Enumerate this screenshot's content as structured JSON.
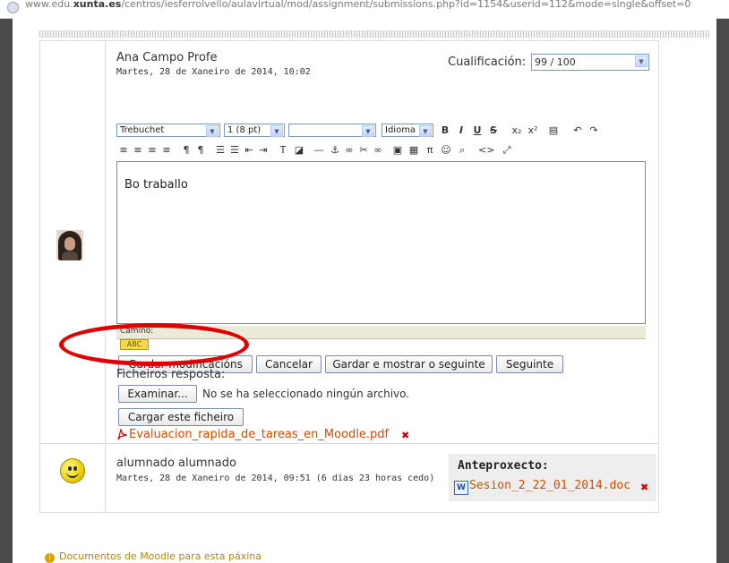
{
  "browser": {
    "url_prefix": "www.edu.",
    "url_domain": "xunta.es",
    "url_path": "/centros/iesferrolvello/aulavirtual/mod/assignment/submissions.php?id=1154&userid=112&mode=single&offset=0"
  },
  "submission": {
    "teacher_name": "Ana Campo Profe",
    "teacher_date": "Martes, 28 de Xaneiro de 2014, 10:02",
    "grade_label": "Cualificación:",
    "grade_value": "99 / 100",
    "toolbar": {
      "font_value": "Trebuchet",
      "size_value": "1 (8 pt)",
      "heading_value": "",
      "language_value": "Idioma",
      "buttons_row1": [
        {
          "name": "bold-icon",
          "glyph": "B"
        },
        {
          "name": "italic-icon",
          "glyph": "I"
        },
        {
          "name": "underline-icon",
          "glyph": "U"
        },
        {
          "name": "strikethrough-icon",
          "glyph": "S"
        },
        {
          "name": "subscript-icon",
          "glyph": "x₂"
        },
        {
          "name": "superscript-icon",
          "glyph": "x²"
        },
        {
          "name": "paste-word-icon",
          "glyph": "▤"
        },
        {
          "name": "undo-icon",
          "glyph": "↶"
        },
        {
          "name": "redo-icon",
          "glyph": "↷"
        }
      ],
      "buttons_row2": [
        {
          "name": "align-left-icon",
          "glyph": "≡"
        },
        {
          "name": "align-center-icon",
          "glyph": "≡"
        },
        {
          "name": "align-right-icon",
          "glyph": "≡"
        },
        {
          "name": "justify-icon",
          "glyph": "≡"
        },
        {
          "name": "ltr-icon",
          "glyph": "¶"
        },
        {
          "name": "rtl-icon",
          "glyph": "¶"
        },
        {
          "name": "ordered-list-icon",
          "glyph": "☰"
        },
        {
          "name": "unordered-list-icon",
          "glyph": "☰"
        },
        {
          "name": "outdent-icon",
          "glyph": "⇤"
        },
        {
          "name": "indent-icon",
          "glyph": "⇥"
        },
        {
          "name": "text-color-icon",
          "glyph": "T"
        },
        {
          "name": "background-color-icon",
          "glyph": "◪"
        },
        {
          "name": "horizontal-rule-icon",
          "glyph": "—"
        },
        {
          "name": "anchor-icon",
          "glyph": "⚓"
        },
        {
          "name": "link-icon",
          "glyph": "∞"
        },
        {
          "name": "unlink-icon",
          "glyph": "✂"
        },
        {
          "name": "nolink-icon",
          "glyph": "∞"
        },
        {
          "name": "image-icon",
          "glyph": "▣"
        },
        {
          "name": "table-icon",
          "glyph": "▦"
        },
        {
          "name": "equation-icon",
          "glyph": "π"
        },
        {
          "name": "emoticon-icon",
          "glyph": "☺"
        },
        {
          "name": "search-replace-icon",
          "glyph": "⌕"
        },
        {
          "name": "html-source-icon",
          "glyph": "<>"
        },
        {
          "name": "fullscreen-icon",
          "glyph": "⤢"
        }
      ]
    },
    "editor_text": "Bo traballo",
    "path_label": "Camiño:",
    "buttons": {
      "save": "Gardar modificacións",
      "cancel": "Cancelar",
      "save_next": "Gardar e mostrar o seguinte",
      "next": "Seguinte"
    },
    "files_label": "Ficheiros resposta:",
    "browse_button": "Examinar...",
    "no_file_text": "No se ha seleccionado ningún archivo.",
    "upload_button": "Cargar este ficheiro",
    "pdf_file": "Evaluacion_rapida_de_tareas_en_Moodle.pdf"
  },
  "student": {
    "name": "alumnado alumnado",
    "date": "Martes, 28 de Xaneiro de 2014, 09:51 (6 días 23 horas cedo)",
    "draft_title": "Anteproxecto:",
    "draft_file": "Sesion_2_22_01_2014.doc"
  },
  "footer": {
    "docs_link": "Documentos de Moodle para esta páxina"
  },
  "colors": {
    "link": "#d04c00",
    "highlight_ellipse": "#e00000",
    "path_bar": "#ecead8"
  }
}
